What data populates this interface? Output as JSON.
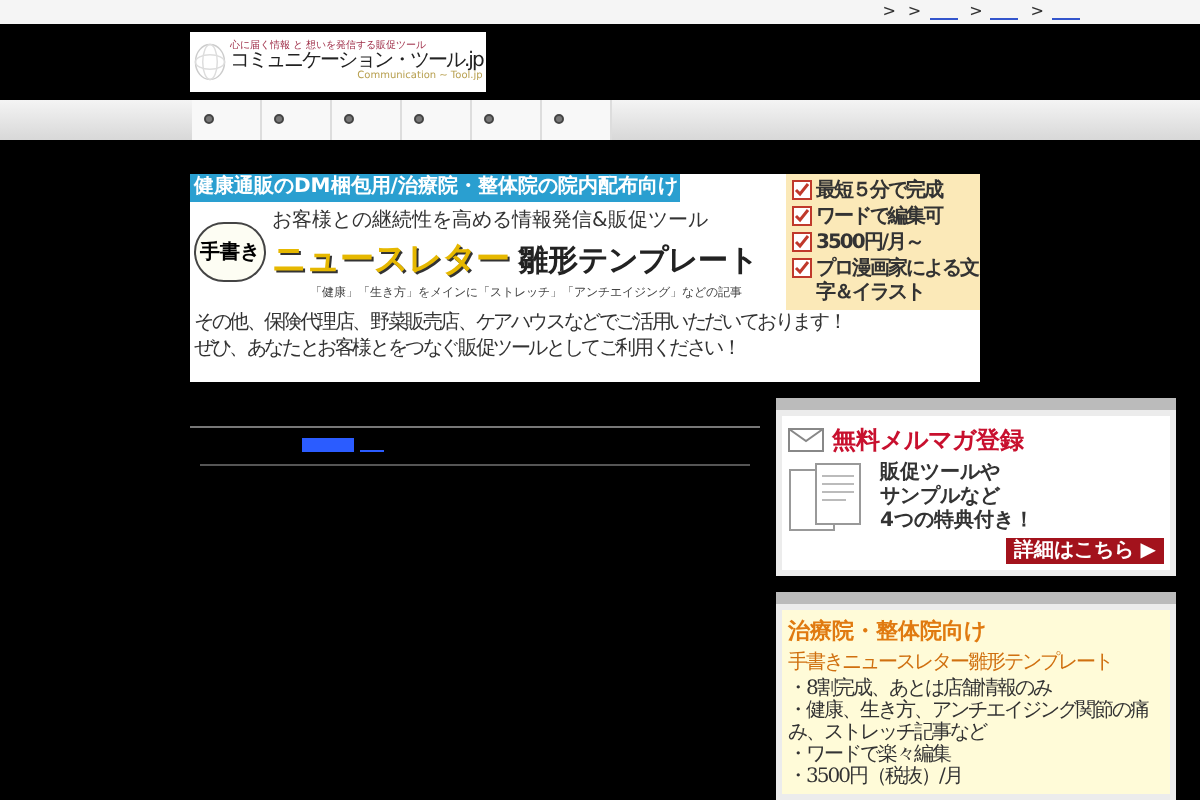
{
  "breadcrumb": {
    "separators": [
      ">",
      ">",
      ">",
      ">"
    ]
  },
  "logo": {
    "tagline": "心に届く情報 と 想いを発信する販促ツール",
    "name": "コミュニケーション・ツール.jp",
    "subname": "Communication ~ Tool.jp"
  },
  "nav": {
    "items": [
      {
        "selected": false
      },
      {
        "selected": false
      },
      {
        "selected": false
      },
      {
        "selected": false
      },
      {
        "selected": false
      },
      {
        "selected": false
      }
    ]
  },
  "banner": {
    "ribbon": "健康通販のDM梱包用/治療院・整体院の院内配布向け",
    "stamp": "手書き",
    "lead": "お客様との継続性を高める情報発信&販促ツール",
    "title": "ニュースレター",
    "title2": "雛形テンプレート",
    "topics": "「健康」「生き方」をメインに「ストレッチ」「アンチエイジング」などの記事",
    "notes": [
      "その他、保険代理店、野菜販売店、ケアハウスなどでご活用いただいております！",
      "ぜひ、あなたとお客様とをつなぐ販促ツールとしてご利用ください！"
    ],
    "features": [
      {
        "text": "最短５分で完成",
        "checked": true
      },
      {
        "text": "ワードで編集可",
        "checked": true
      },
      {
        "text": "3500円/月～",
        "checked": true
      },
      {
        "text": "プロ漫画家による文字＆イラスト",
        "checked": true
      }
    ]
  },
  "sidebar": [
    {
      "kind": "mail",
      "title": "無料メルマガ登録",
      "body": [
        "販促ツールや",
        "サンプルなど",
        "4つの特典付き！"
      ],
      "button": "詳細はこちら ▶"
    },
    {
      "kind": "list",
      "title": "治療院・整体院向け",
      "subtitle": "手書きニュースレター雛形テンプレート",
      "bullets": [
        "・8割完成、あとは店舗情報のみ",
        "・健康、生き方、アンチエイジング関節の痛み、ストレッチ記事など",
        "・ワードで楽々編集",
        "・3500円（税抜）/月"
      ]
    }
  ]
}
